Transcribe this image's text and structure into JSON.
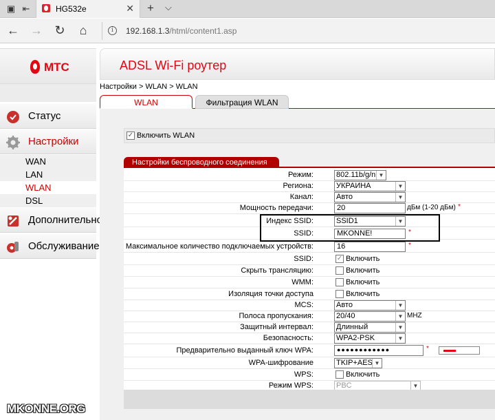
{
  "browser": {
    "tab_title": "HG532e",
    "url_host": "192.168.1.3",
    "url_path": "/html/content1.asp"
  },
  "sidebar": {
    "logo": "МТС",
    "menu": [
      {
        "label": "Статус",
        "icon": "status-icon"
      },
      {
        "label": "Настройки",
        "icon": "gear-icon"
      },
      {
        "label": "Дополнительно",
        "icon": "tools-icon"
      },
      {
        "label": "Обслуживание",
        "icon": "maintenance-icon"
      }
    ],
    "submenu": [
      "WAN",
      "LAN",
      "WLAN",
      "DSL"
    ],
    "active_sub": "WLAN"
  },
  "header": {
    "title": "ADSL Wi-Fi роутер"
  },
  "breadcrumb": "Настройки > WLAN > WLAN",
  "tabs": [
    "WLAN",
    "Фильтрация WLAN"
  ],
  "enable_wlan": "Включить WLAN",
  "section_title": "Настройки беспроводного соединения",
  "form": {
    "mode": {
      "label": "Режим:",
      "value": "802.11b/g/n"
    },
    "region": {
      "label": "Регионa:",
      "value": "УКРАИНА"
    },
    "channel": {
      "label": "Канал:",
      "value": "Авто"
    },
    "tx_power": {
      "label": "Мощность передачи:",
      "value": "20",
      "hint": "дБм (1-20 дБм)",
      "req": "*"
    },
    "ssid_index": {
      "label": "Индекс SSID:",
      "value": "SSID1"
    },
    "ssid": {
      "label": "SSID:",
      "value": "MKONNE!",
      "req": "*"
    },
    "max_devices": {
      "label": "Максимальное количество подключаемых устройств:",
      "value": "16",
      "req": "*"
    },
    "ssid_enable": {
      "label": "SSID:",
      "text": "Включить"
    },
    "hide_broadcast": {
      "label": "Скрыть трансляцию:",
      "text": "Включить"
    },
    "wmm": {
      "label": "WMM:",
      "text": "Включить"
    },
    "ap_isolation": {
      "label": "Изоляция точки доступа",
      "text": "Включить"
    },
    "mcs": {
      "label": "MCS:",
      "value": "Авто"
    },
    "bandwidth": {
      "label": "Полоса пропускания:",
      "value": "20/40",
      "hint": "MHZ"
    },
    "guard_interval": {
      "label": "Защитный интервал:",
      "value": "Длинный"
    },
    "security": {
      "label": "Безопасность:",
      "value": "WPA2-PSK"
    },
    "wpa_key": {
      "label": "Предварительно выданный ключ WPA:",
      "value": "●●●●●●●●●●●●",
      "req": "*"
    },
    "wpa_encryption": {
      "label": "WPA-шифрование",
      "value": "TKIP+AES"
    },
    "wps": {
      "label": "WPS:",
      "text": "Включить"
    },
    "wps_mode": {
      "label": "Режим WPS:",
      "value": "PBC"
    }
  },
  "watermark": "MKONNE.ORG"
}
